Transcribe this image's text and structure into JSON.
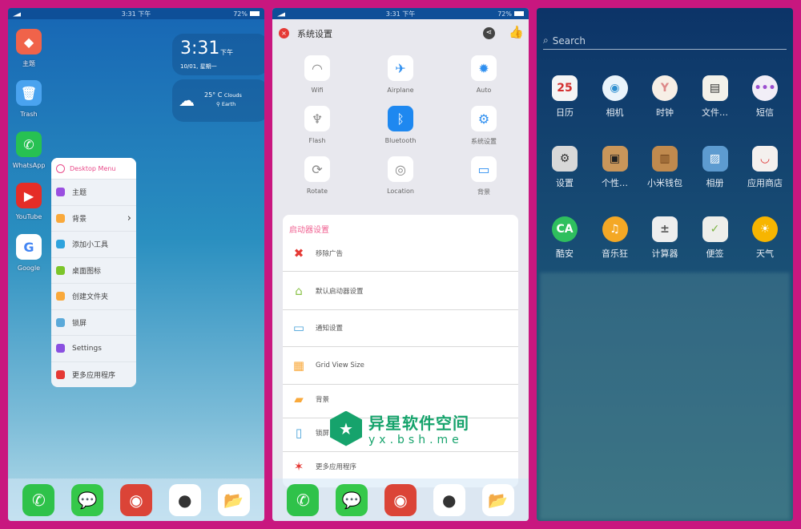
{
  "status": {
    "time": "3:31 下午",
    "battery": "72%"
  },
  "home": {
    "desktop_apps": [
      {
        "label": "主题",
        "color": "#f0634a",
        "glyph": "◆"
      },
      {
        "label": "Trash",
        "color": "#4aa3ef",
        "glyph": "🗑"
      },
      {
        "label": "WhatsApp",
        "color": "#27c152",
        "glyph": "✆"
      },
      {
        "label": "YouTube",
        "color": "#e52d27",
        "glyph": "▶"
      },
      {
        "label": "Google",
        "color": "#ffffff",
        "glyph": "G"
      }
    ],
    "clock": {
      "time": "3:31",
      "ampm": "下午",
      "date": "10/01, 星期一"
    },
    "weather": {
      "temp": "25°",
      "unit": "C",
      "condition": "Clouds",
      "location": "Earth",
      "icon": "cloud-icon"
    },
    "menu": {
      "title": "Desktop Menu",
      "items": [
        {
          "label": "主题",
          "color": "#9a4fe0"
        },
        {
          "label": "背景",
          "color": "#f9a93b",
          "chevron": true
        },
        {
          "label": "添加小工具",
          "color": "#2ea3dd"
        },
        {
          "label": "桌面图标",
          "color": "#7cc52a"
        },
        {
          "label": "创建文件夹",
          "color": "#f9a93b"
        },
        {
          "label": "锁屏",
          "color": "#5aa9d9"
        },
        {
          "label": "Settings",
          "color": "#8a50e0"
        },
        {
          "label": "更多应用程序",
          "color": "#e53935"
        }
      ]
    }
  },
  "dock": [
    {
      "name": "phone",
      "color": "#2fc24a",
      "glyph": "✆"
    },
    {
      "name": "messages",
      "color": "#35c84a",
      "glyph": "💬"
    },
    {
      "name": "chrome",
      "color": "#db4437",
      "glyph": "◉"
    },
    {
      "name": "camera",
      "color": "#ffffff",
      "glyph": "●"
    },
    {
      "name": "files",
      "color": "#ffffff",
      "glyph": "📂"
    }
  ],
  "settings": {
    "title": "系统设置",
    "quick": [
      {
        "label": "Wifi",
        "glyph": "◠",
        "color": "#888"
      },
      {
        "label": "Airplane",
        "glyph": "✈",
        "color": "#2e8ff0"
      },
      {
        "label": "Auto",
        "glyph": "✹",
        "color": "#2e8ff0"
      },
      {
        "label": "Flash",
        "glyph": "♆",
        "color": "#888"
      },
      {
        "label": "Bluetooth",
        "glyph": "ᛒ",
        "color": "#fff",
        "active": true
      },
      {
        "label": "系统设置",
        "glyph": "⚙",
        "color": "#2e8ff0"
      },
      {
        "label": "Rotate",
        "glyph": "⟳",
        "color": "#888"
      },
      {
        "label": "Location",
        "glyph": "◎",
        "color": "#888"
      },
      {
        "label": "背景",
        "glyph": "▭",
        "color": "#2e8ff0"
      }
    ],
    "section_title": "启动器设置",
    "rows": [
      {
        "label": "移除广告",
        "glyph": "✖",
        "color": "#e53935"
      },
      {
        "label": "默认启动器设置",
        "glyph": "⌂",
        "color": "#8bc34a"
      },
      {
        "label": "通知设置",
        "glyph": "▭",
        "color": "#4aa3d9"
      },
      {
        "label": "Grid View Size",
        "glyph": "▦",
        "color": "#f9a93b"
      },
      {
        "label": "背景",
        "glyph": "▰",
        "color": "#f9a93b"
      },
      {
        "label": "锁屏",
        "glyph": "▯",
        "color": "#4aa3d9"
      },
      {
        "label": "更多应用程序",
        "glyph": "✶",
        "color": "#e53935"
      }
    ]
  },
  "drawer": {
    "search_placeholder": "Search",
    "apps": [
      {
        "label": "日历",
        "bg": "#f5f5f5",
        "fg": "#d32f2f",
        "glyph": "25"
      },
      {
        "label": "相机",
        "bg": "#eaf4fb",
        "fg": "#2f8fd0",
        "glyph": "◉"
      },
      {
        "label": "时钟",
        "bg": "#f7efe6",
        "fg": "#d88",
        "glyph": "Y"
      },
      {
        "label": "文件…",
        "bg": "#f3f1ea",
        "fg": "#333",
        "glyph": "▤"
      },
      {
        "label": "短信",
        "bg": "#f2eef7",
        "fg": "#9c4fd0",
        "glyph": "•••"
      },
      {
        "label": "设置",
        "bg": "#d8d8d8",
        "fg": "#333",
        "glyph": "⚙"
      },
      {
        "label": "个性…",
        "bg": "#c9965a",
        "fg": "#222",
        "glyph": "▣"
      },
      {
        "label": "小米钱包",
        "bg": "#c08a4e",
        "fg": "#6b3f17",
        "glyph": "▥"
      },
      {
        "label": "相册",
        "bg": "#5d9bd0",
        "fg": "#fff",
        "glyph": "▨"
      },
      {
        "label": "应用商店",
        "bg": "#f4f0ee",
        "fg": "#d33",
        "glyph": "◡"
      },
      {
        "label": "酷安",
        "bg": "#2fbf5e",
        "fg": "#fff",
        "glyph": "CA"
      },
      {
        "label": "音乐狂",
        "bg": "#f4a825",
        "fg": "#fff",
        "glyph": "♫"
      },
      {
        "label": "计算器",
        "bg": "#eeeeee",
        "fg": "#555",
        "glyph": "±"
      },
      {
        "label": "便签",
        "bg": "#eeeeea",
        "fg": "#7cb342",
        "glyph": "✓"
      },
      {
        "label": "天气",
        "bg": "#f7b500",
        "fg": "#fff",
        "glyph": "☀"
      }
    ]
  },
  "watermark": {
    "title": "异星软件空间",
    "url": "yx.bsh.me"
  }
}
